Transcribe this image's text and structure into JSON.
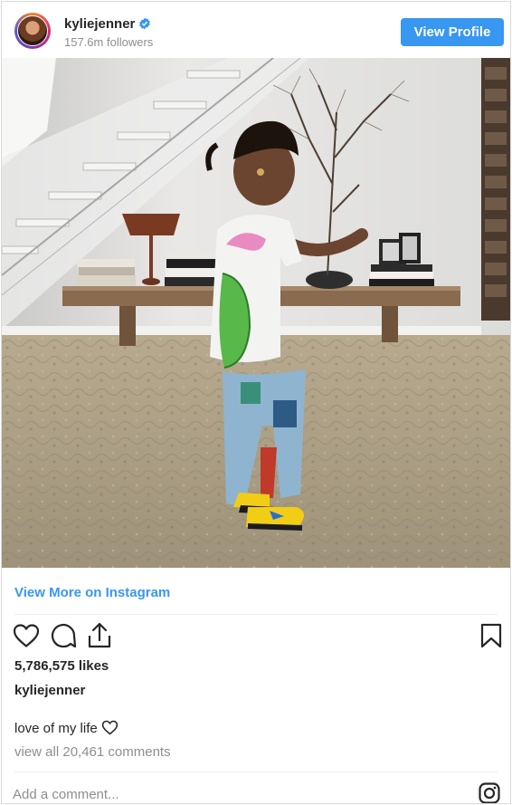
{
  "header": {
    "username": "kyliejenner",
    "followers": "157.6m followers",
    "view_profile_label": "View Profile",
    "verified_icon": "verified-badge-icon"
  },
  "post": {
    "image_icon": "photo",
    "view_more_label": "View More on Instagram",
    "likes": "5,786,575 likes",
    "owner": "kyliejenner",
    "caption": "love of my life",
    "caption_icon": "heart-outline-icon",
    "comments_link": "view all 20,461 comments",
    "comment_placeholder": "Add a comment..."
  },
  "actions": {
    "like_icon": "heart-icon",
    "comment_icon": "comment-icon",
    "share_icon": "share-icon",
    "save_icon": "bookmark-icon",
    "brand_icon": "instagram-icon"
  },
  "colors": {
    "accent": "#3897f0",
    "text": "#262626",
    "muted": "#8e8e8e",
    "border": "#dbdbdb"
  }
}
